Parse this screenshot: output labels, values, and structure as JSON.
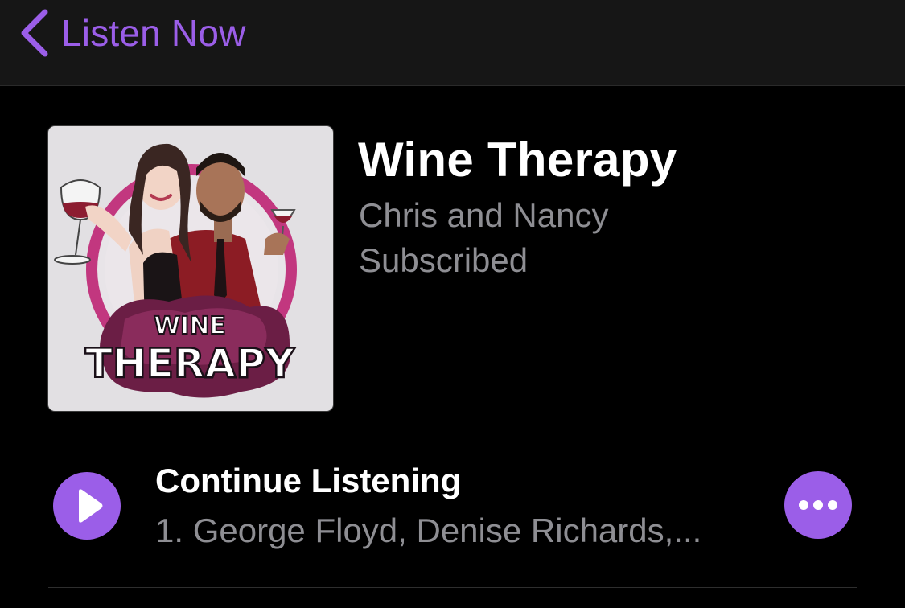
{
  "navbar": {
    "back_label": "Listen Now",
    "back_icon": "chevron-left-icon"
  },
  "show": {
    "title": "Wine Therapy",
    "author": "Chris and Nancy",
    "status": "Subscribed",
    "artwork": {
      "line1": "WINE",
      "line2": "THERAPY"
    }
  },
  "episode_row": {
    "title": "Continue Listening",
    "subtitle": "1. George Floyd, Denise Richards,...",
    "play_icon": "play-icon",
    "more_icon": "ellipsis-icon"
  },
  "colors": {
    "accent": "#9b5ee8",
    "background": "#000000",
    "navbar": "#161616",
    "secondary_text": "#8e8e93"
  }
}
